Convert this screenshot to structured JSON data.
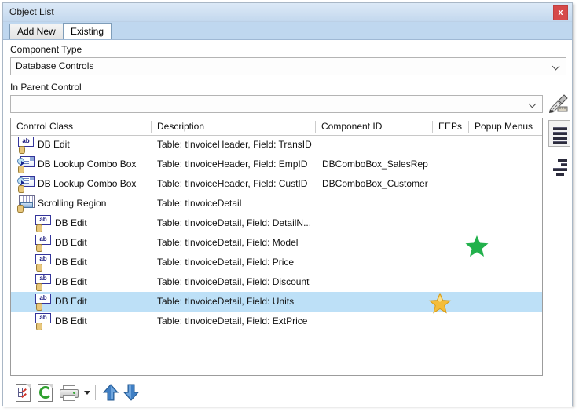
{
  "window": {
    "title": "Object List",
    "close_label": "x"
  },
  "tabs": [
    {
      "label": "Add New",
      "active": false
    },
    {
      "label": "Existing",
      "active": true
    }
  ],
  "form": {
    "component_type": {
      "label": "Component Type",
      "value": "Database Controls",
      "icon": "chevron-down-icon"
    },
    "in_parent_control": {
      "label": "In Parent Control",
      "value": "",
      "placeholder": "",
      "icon": "chevron-down-icon"
    },
    "ruler_button_icon": "ruler-pencil-icon"
  },
  "grid": {
    "columns": [
      {
        "key": "control_class",
        "label": "Control Class"
      },
      {
        "key": "description",
        "label": "Description"
      },
      {
        "key": "component_id",
        "label": "Component ID"
      },
      {
        "key": "eeps",
        "label": "EEPs"
      },
      {
        "key": "popup_menus",
        "label": "Popup Menus"
      }
    ],
    "rows": [
      {
        "icon": "db-edit-icon",
        "indent": 0,
        "control_class": "DB Edit",
        "description": "Table: tInvoiceHeader, Field: TransID",
        "component_id": "",
        "eeps": "",
        "popup_menus": "",
        "selected": false,
        "marker": ""
      },
      {
        "icon": "db-lookup-combo-icon",
        "indent": 0,
        "control_class": "DB Lookup Combo Box",
        "description": "Table: tInvoiceHeader, Field: EmpID",
        "component_id": "DBComboBox_SalesRep",
        "eeps": "",
        "popup_menus": "",
        "selected": false,
        "marker": ""
      },
      {
        "icon": "db-lookup-combo-icon",
        "indent": 0,
        "control_class": "DB Lookup Combo Box",
        "description": "Table: tInvoiceHeader, Field: CustID",
        "component_id": "DBComboBox_Customer",
        "eeps": "",
        "popup_menus": "",
        "selected": false,
        "marker": ""
      },
      {
        "icon": "scrolling-region-icon",
        "indent": 0,
        "control_class": "Scrolling Region",
        "description": "Table: tInvoiceDetail",
        "component_id": "",
        "eeps": "",
        "popup_menus": "",
        "selected": false,
        "marker": ""
      },
      {
        "icon": "db-edit-icon",
        "indent": 1,
        "control_class": "DB Edit",
        "description": "Table: tInvoiceDetail, Field: DetailN...",
        "component_id": "",
        "eeps": "",
        "popup_menus": "",
        "selected": false,
        "marker": ""
      },
      {
        "icon": "db-edit-icon",
        "indent": 1,
        "control_class": "DB Edit",
        "description": "Table: tInvoiceDetail, Field: Model",
        "component_id": "",
        "eeps": "",
        "popup_menus": "",
        "selected": false,
        "marker": "green-star"
      },
      {
        "icon": "db-edit-icon",
        "indent": 1,
        "control_class": "DB Edit",
        "description": "Table: tInvoiceDetail, Field: Price",
        "component_id": "",
        "eeps": "",
        "popup_menus": "",
        "selected": false,
        "marker": ""
      },
      {
        "icon": "db-edit-icon",
        "indent": 1,
        "control_class": "DB Edit",
        "description": "Table: tInvoiceDetail, Field: Discount",
        "component_id": "",
        "eeps": "",
        "popup_menus": "",
        "selected": false,
        "marker": ""
      },
      {
        "icon": "db-edit-icon",
        "indent": 1,
        "control_class": "DB Edit",
        "description": "Table: tInvoiceDetail, Field: Units",
        "component_id": "",
        "eeps": "",
        "popup_menus": "",
        "selected": true,
        "marker": "gold-star"
      },
      {
        "icon": "db-edit-icon",
        "indent": 1,
        "control_class": "DB Edit",
        "description": "Table: tInvoiceDetail, Field: ExtPrice",
        "component_id": "",
        "eeps": "",
        "popup_menus": "",
        "selected": false,
        "marker": ""
      }
    ]
  },
  "side_toolbar": [
    {
      "icon": "align-justify-icon",
      "active": true
    },
    {
      "icon": "align-right-icon",
      "active": false
    }
  ],
  "bottom_toolbar": [
    {
      "icon": "checklist-page-icon"
    },
    {
      "icon": "refresh-page-icon"
    },
    {
      "icon": "print-icon"
    },
    {
      "icon": "print-dropdown-caret-icon"
    },
    {
      "icon": "move-up-arrow-icon"
    },
    {
      "icon": "move-down-arrow-icon"
    }
  ],
  "colors": {
    "titlebar_top": "#dce9f7",
    "titlebar_bottom": "#c3d8ee",
    "tabstrip": "#bfd7ef",
    "close_button": "#d64a4a",
    "selected_row": "#bde0f7",
    "green_star": "#22b14c",
    "gold_star": "#f0b429"
  }
}
